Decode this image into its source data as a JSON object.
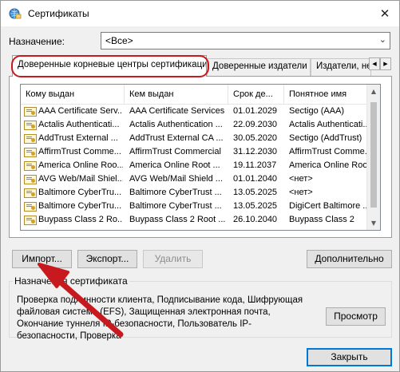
{
  "window": {
    "title": "Сертификаты",
    "close_glyph": "✕",
    "app_icon": "certificate-globe-icon"
  },
  "purpose": {
    "label": "Назначение:",
    "value": "<Все>",
    "arrow_glyph": "⌄"
  },
  "tabs": [
    {
      "label": "Доверенные корневые центры сертификации",
      "active": true
    },
    {
      "label": "Доверенные издатели",
      "active": false
    },
    {
      "label": "Издатели, не",
      "active": false
    }
  ],
  "tab_scroll": {
    "left_glyph": "◀",
    "right_glyph": "▶"
  },
  "list": {
    "columns": [
      "Кому выдан",
      "Кем выдан",
      "Срок де...",
      "Понятное имя"
    ],
    "rows": [
      {
        "issued_to": "AAA Certificate Serv...",
        "issued_by": "AAA Certificate Services",
        "expires": "01.01.2029",
        "friendly_name": "Sectigo (AAA)"
      },
      {
        "issued_to": "Actalis Authenticati...",
        "issued_by": "Actalis Authentication ...",
        "expires": "22.09.2030",
        "friendly_name": "Actalis Authenticati..."
      },
      {
        "issued_to": "AddTrust External ...",
        "issued_by": "AddTrust External CA ...",
        "expires": "30.05.2020",
        "friendly_name": "Sectigo (AddTrust)"
      },
      {
        "issued_to": "AffirmTrust Comme...",
        "issued_by": "AffirmTrust Commercial",
        "expires": "31.12.2030",
        "friendly_name": "AffirmTrust Comme..."
      },
      {
        "issued_to": "America Online Roo...",
        "issued_by": "America Online Root ...",
        "expires": "19.11.2037",
        "friendly_name": "America Online Roo..."
      },
      {
        "issued_to": "AVG Web/Mail Shiel...",
        "issued_by": "AVG Web/Mail Shield ...",
        "expires": "01.01.2040",
        "friendly_name": "<нет>"
      },
      {
        "issued_to": "Baltimore CyberTru...",
        "issued_by": "Baltimore CyberTrust ...",
        "expires": "13.05.2025",
        "friendly_name": "<нет>"
      },
      {
        "issued_to": "Baltimore CyberTru...",
        "issued_by": "Baltimore CyberTrust ...",
        "expires": "13.05.2025",
        "friendly_name": "DigiCert Baltimore ..."
      },
      {
        "issued_to": "Buypass Class 2 Ro...",
        "issued_by": "Buypass Class 2 Root ...",
        "expires": "26.10.2040",
        "friendly_name": "Buypass Class 2"
      }
    ],
    "row_icon": "certificate-icon",
    "scroll_up_glyph": "▲",
    "scroll_down_glyph": "▼"
  },
  "buttons": {
    "import": "Импорт...",
    "export": "Экспорт...",
    "remove": "Удалить",
    "advanced": "Дополнительно",
    "view": "Просмотр",
    "close": "Закрыть"
  },
  "purposes_group": {
    "title": "Назначения сертификата",
    "text": "Проверка подлинности клиента, Подписывание кода, Шифрующая файловая система (EFS), Защищенная электронная почта, Окончание туннеля IP-безопасности, Пользователь IP-безопасности, Проверка"
  },
  "annotation": {
    "color": "#c8191e"
  }
}
